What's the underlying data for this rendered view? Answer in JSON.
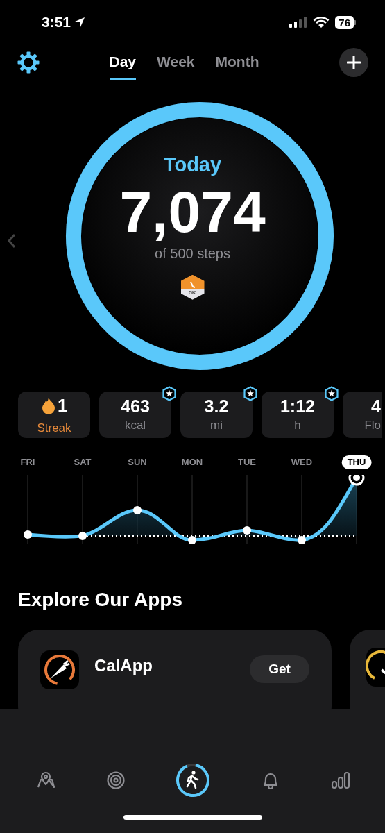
{
  "status_bar": {
    "time": "3:51",
    "battery": "76"
  },
  "header": {
    "tabs": [
      {
        "label": "Day",
        "selected": true
      },
      {
        "label": "Week",
        "selected": false
      },
      {
        "label": "Month",
        "selected": false
      }
    ]
  },
  "ring": {
    "title": "Today",
    "value": "7,074",
    "subtitle": "of 500 steps",
    "badge": "5K",
    "level": 1
  },
  "stats": [
    {
      "kind": "streak",
      "value": "1",
      "label": "Streak",
      "badge": false
    },
    {
      "kind": "metric",
      "value": "463",
      "label": "kcal",
      "badge": true
    },
    {
      "kind": "metric",
      "value": "3.2",
      "label": "mi",
      "badge": true
    },
    {
      "kind": "metric",
      "value": "1:12",
      "label": "h",
      "badge": true
    },
    {
      "kind": "metric",
      "value": "4",
      "label": "Flo",
      "badge": false
    }
  ],
  "week": [
    {
      "label": "FRI",
      "selected": false
    },
    {
      "label": "SAT",
      "selected": false
    },
    {
      "label": "SUN",
      "selected": false
    },
    {
      "label": "MON",
      "selected": false
    },
    {
      "label": "TUE",
      "selected": false
    },
    {
      "label": "WED",
      "selected": false
    },
    {
      "label": "THU",
      "selected": true
    }
  ],
  "explore": {
    "title": "Explore Our Apps",
    "apps": [
      {
        "name": "CalApp",
        "button": "Get"
      }
    ]
  },
  "tab_bar": [
    {
      "kind": "map",
      "selected": false
    },
    {
      "kind": "target",
      "selected": false
    },
    {
      "kind": "walk",
      "selected": true
    },
    {
      "kind": "bell",
      "selected": false
    },
    {
      "kind": "chart",
      "selected": false
    }
  ]
}
